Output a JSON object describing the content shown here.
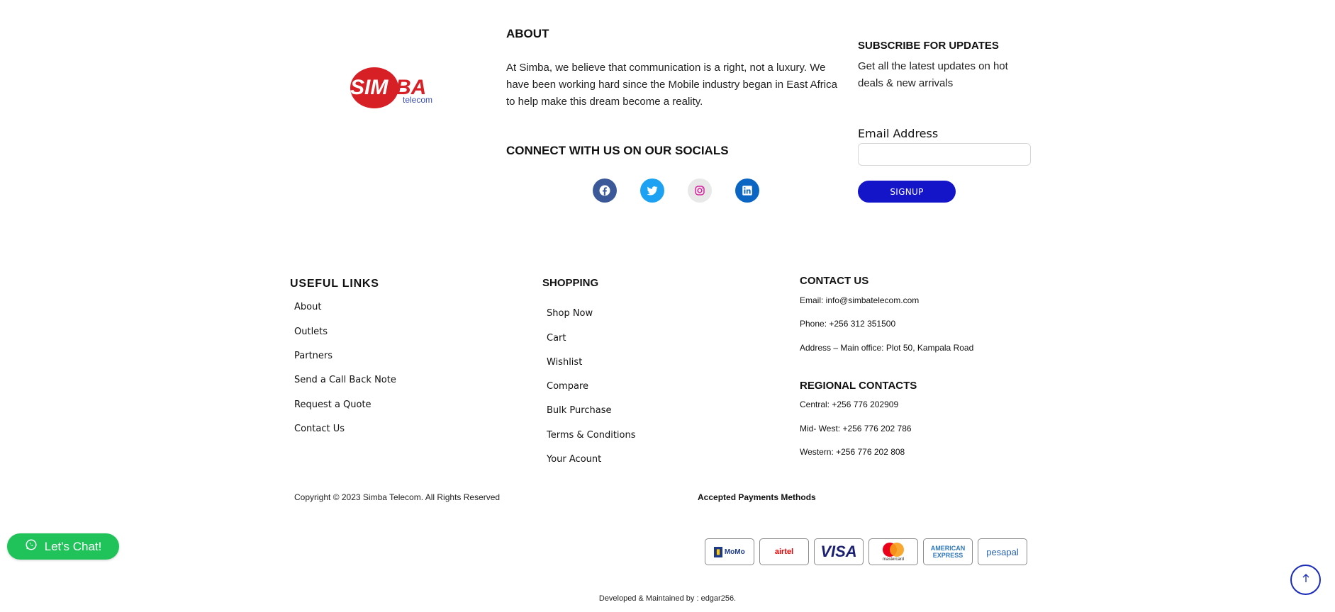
{
  "brand": {
    "logo_word": "SIMBA",
    "logo_sub": "telecom",
    "accent": "#d71f26"
  },
  "about": {
    "title": "ABOUT",
    "text": " At Simba, we believe that communication is a right, not a luxury. We have been working hard since the Mobile industry began in East Africa to help make this dream become a reality."
  },
  "socials": {
    "title": "CONNECT WITH US ON OUR SOCIALS",
    "items": [
      {
        "icon": "facebook-icon",
        "color": "#3b5998"
      },
      {
        "icon": "twitter-icon",
        "color": "#1da1f2"
      },
      {
        "icon": "instagram-icon",
        "color": "#e8e8e8"
      },
      {
        "icon": "linkedin-icon",
        "color": "#0a66c2"
      }
    ]
  },
  "subscribe": {
    "title": "SUBSCRIBE FOR UPDATES",
    "text": "Get all the latest updates on hot deals & new arrivals",
    "email_label": "Email Address",
    "email_value": "",
    "button": "SIGNUP"
  },
  "useful_links": {
    "title": "USEFUL LINKS",
    "items": [
      "About",
      "Outlets",
      "Partners",
      "Send a Call Back Note",
      "Request a Quote",
      "Contact Us"
    ]
  },
  "shopping": {
    "title": "SHOPPING",
    "items": [
      "Shop Now",
      "Cart",
      "Wishlist",
      "Compare",
      "Bulk Purchase",
      "Terms & Conditions",
      "Your Acount"
    ]
  },
  "contact": {
    "title": "CONTACT US",
    "email": "Email: info@simbatelecom.com",
    "phone": "Phone: +256 312 351500",
    "address": "Address – Main office: Plot 50, Kampala Road"
  },
  "regional": {
    "title": "REGIONAL CONTACTS",
    "central": "Central: +256 776 202909",
    "midwest": "Mid- West: +256 776 202 786",
    "western": "Western: +256 776 202 808"
  },
  "footer": {
    "copyright": "Copyright © 2023 Simba Telecom. All Rights Reserved",
    "payments_title": "Accepted Payments Methods",
    "payments": [
      "MoMo",
      "airtel",
      "VISA",
      "mastercard",
      "AMERICAN EXPRESS",
      "pesapal"
    ],
    "developed": "Developed & Maintained by : edgar256."
  },
  "chat": {
    "label": "Let's Chat!",
    "color": "#1fc35a"
  },
  "primary_color": "#1414c8"
}
